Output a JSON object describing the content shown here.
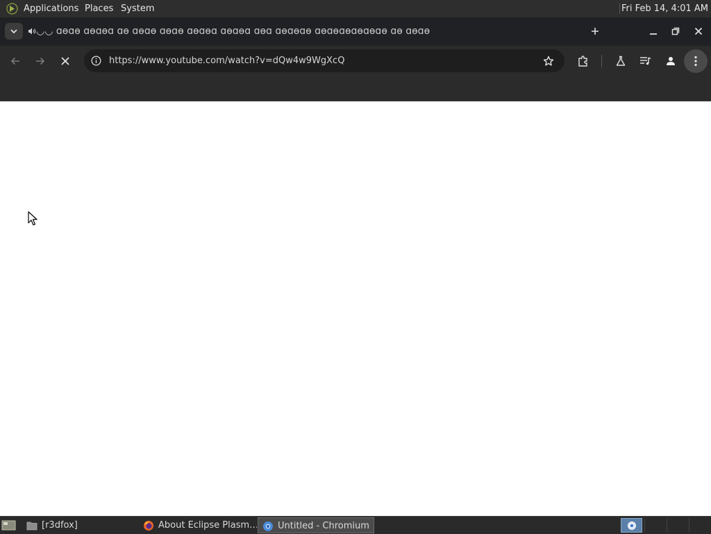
{
  "top_panel": {
    "menus": [
      "Applications",
      "Places",
      "System"
    ],
    "clock": "Fri Feb 14,  4:01 AM"
  },
  "tab": {
    "title": "◡◡ ɑɵɑɵ ɑɵɑɵɑ ɑɵ ɑɵɑɵ ɑɵɑɵ ɑɵɑɵɑ ɑɵɑɵɑ ɑɵɑ ɑɵɑɵɑɵ ɑɵɑɵɑɵɑɵɑɵɑɵ ɑɵ ɑɵɑɵ"
  },
  "toolbar": {
    "url": "https://www.youtube.com/watch?v=dQw4w9WgXcQ"
  },
  "taskbar": {
    "tasks": [
      {
        "label": "[r3dfox]",
        "icon": "folder-icon"
      },
      {
        "label": "About Eclipse Plasm…",
        "icon": "firefox-icon"
      },
      {
        "label": "Untitled - Chromium",
        "icon": "chromium-icon"
      }
    ]
  }
}
